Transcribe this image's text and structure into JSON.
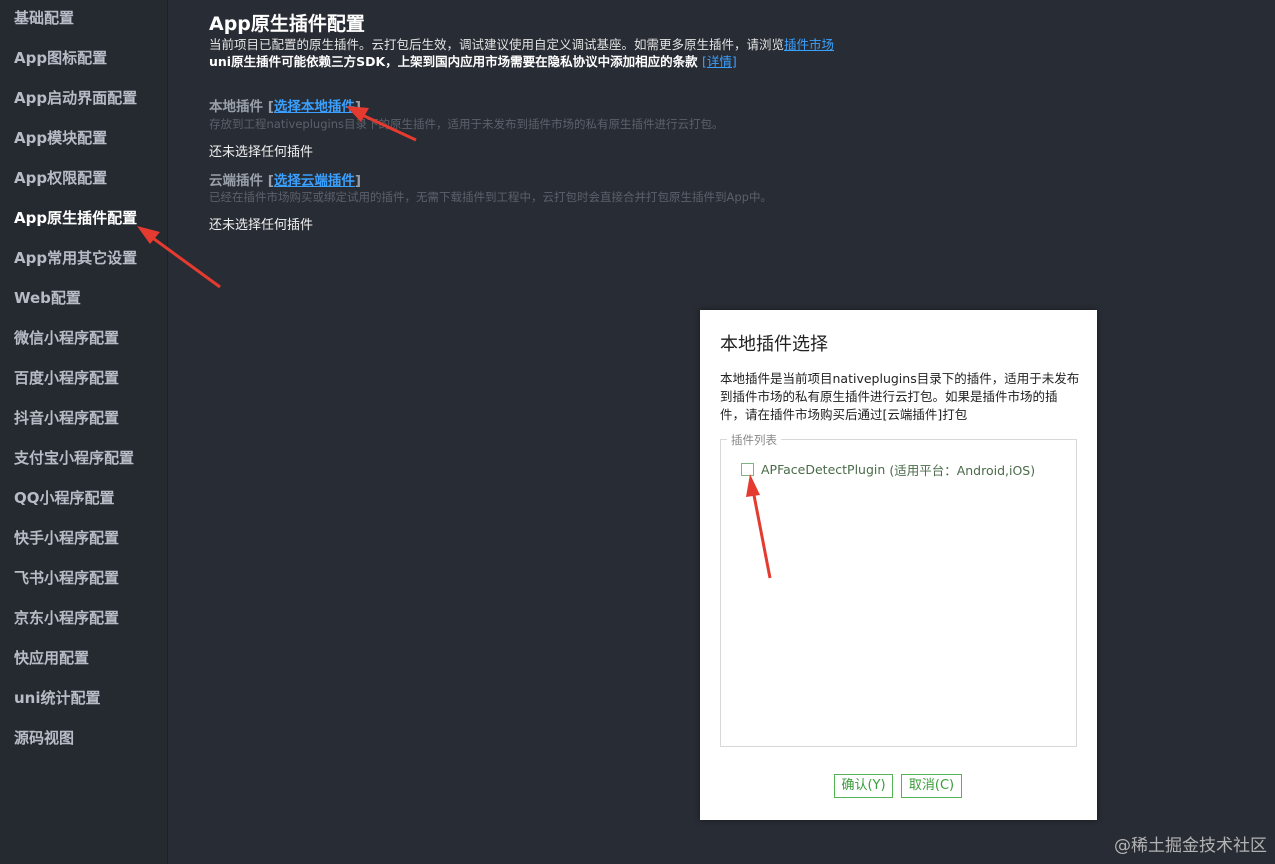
{
  "sidebar": {
    "items": [
      {
        "label": "基础配置",
        "active": false
      },
      {
        "label": "App图标配置",
        "active": false
      },
      {
        "label": "App启动界面配置",
        "active": false
      },
      {
        "label": "App模块配置",
        "active": false
      },
      {
        "label": "App权限配置",
        "active": false
      },
      {
        "label": "App原生插件配置",
        "active": true
      },
      {
        "label": "App常用其它设置",
        "active": false
      },
      {
        "label": "Web配置",
        "active": false
      },
      {
        "label": "微信小程序配置",
        "active": false
      },
      {
        "label": "百度小程序配置",
        "active": false
      },
      {
        "label": "抖音小程序配置",
        "active": false
      },
      {
        "label": "支付宝小程序配置",
        "active": false
      },
      {
        "label": "QQ小程序配置",
        "active": false
      },
      {
        "label": "快手小程序配置",
        "active": false
      },
      {
        "label": "飞书小程序配置",
        "active": false
      },
      {
        "label": "京东小程序配置",
        "active": false
      },
      {
        "label": "快应用配置",
        "active": false
      },
      {
        "label": "uni统计配置",
        "active": false
      },
      {
        "label": "源码视图",
        "active": false
      }
    ]
  },
  "main": {
    "title": "App原生插件配置",
    "desc_text": "当前项目已配置的原生插件。云打包后生效，调试建议使用自定义调试基座。如需更多原生插件，请浏览",
    "desc_link": "插件市场",
    "warning_text": "uni原生插件可能依赖三方SDK，上架到国内应用市场需要在隐私协议中添加相应的条款 ",
    "warning_link": "[详情]",
    "local": {
      "label": "本地插件",
      "bracket_open": "[",
      "link": "选择本地插件",
      "bracket_close": "]",
      "hint": "存放到工程nativeplugins目录下的原生插件，适用于未发布到插件市场的私有原生插件进行云打包。",
      "empty": "还未选择任何插件"
    },
    "cloud": {
      "label": "云端插件",
      "bracket_open": "[",
      "link": "选择云端插件",
      "bracket_close": "]",
      "hint": "已经在插件市场购买或绑定试用的插件，无需下载插件到工程中，云打包时会直接合并打包原生插件到App中。",
      "empty": "还未选择任何插件"
    }
  },
  "modal": {
    "title": "本地插件选择",
    "description": "本地插件是当前项目nativeplugins目录下的插件，适用于未发布到插件市场的私有原生插件进行云打包。如果是插件市场的插件，请在插件市场购买后通过[云端插件]打包",
    "legend": "插件列表",
    "plugins": [
      {
        "name": "APFaceDetectPlugin",
        "platform": "(适用平台：Android,iOS)",
        "checked": false
      }
    ],
    "confirm_label": "确认(Y)",
    "cancel_label": "取消(C)"
  },
  "watermark": "@稀土掘金技术社区",
  "colors": {
    "background": "#282c34",
    "sidebar_bg": "#252930",
    "link": "#3aa0ff",
    "button_green": "#52b452",
    "annotation_arrow": "#e53a2f"
  }
}
